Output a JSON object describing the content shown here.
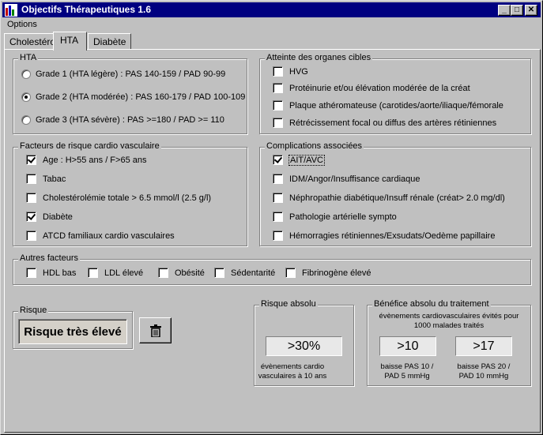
{
  "window": {
    "title": "Objectifs Thérapeutiques 1.6",
    "minimize": "_",
    "maximize": "□",
    "close": "✕"
  },
  "menu": {
    "options": "Options"
  },
  "tabs": [
    {
      "label": "Cholestérol",
      "active": false
    },
    {
      "label": "HTA",
      "active": true
    },
    {
      "label": "Diabète",
      "active": false
    }
  ],
  "hta": {
    "title": "HTA",
    "grades": [
      {
        "label": "Grade 1 (HTA légère) : PAS 140-159 / PAD 90-99",
        "selected": false
      },
      {
        "label": "Grade 2 (HTA modérée) : PAS 160-179 / PAD 100-109",
        "selected": true
      },
      {
        "label": "Grade 3 (HTA sévère) : PAS >=180 / PAD >= 110",
        "selected": false
      }
    ]
  },
  "organ_damage": {
    "title": "Atteinte des organes cibles",
    "items": [
      {
        "label": "HVG",
        "checked": false
      },
      {
        "label": "Protéinurie et/ou élévation modérée de la créat",
        "checked": false
      },
      {
        "label": "Plaque athéromateuse (carotides/aorte/iliaque/fémorale",
        "checked": false
      },
      {
        "label": "Rétrécissement focal ou diffus des artères rétiniennes",
        "checked": false
      }
    ]
  },
  "risk_factors": {
    "title": "Facteurs de risque cardio vasculaire",
    "items": [
      {
        "label": "Age : H>55 ans / F>65 ans",
        "checked": true
      },
      {
        "label": "Tabac",
        "checked": false
      },
      {
        "label": "Cholestérolémie totale > 6.5 mmol/l (2.5 g/l)",
        "checked": false
      },
      {
        "label": "Diabète",
        "checked": true
      },
      {
        "label": "ATCD familiaux cardio vasculaires",
        "checked": false
      }
    ]
  },
  "complications": {
    "title": "Complications associées",
    "items": [
      {
        "label": "AIT/AVC",
        "checked": true
      },
      {
        "label": "IDM/Angor/Insuffisance cardiaque",
        "checked": false
      },
      {
        "label": "Néphropathie diabétique/Insuff rénale (créat> 2.0 mg/dl)",
        "checked": false
      },
      {
        "label": "Pathologie artérielle sympto",
        "checked": false
      },
      {
        "label": "Hémorragies rétiniennes/Exsudats/Oedème papillaire",
        "checked": false
      }
    ]
  },
  "other_factors": {
    "title": "Autres facteurs",
    "items": [
      {
        "label": "HDL bas",
        "checked": false
      },
      {
        "label": "LDL élevé",
        "checked": false
      },
      {
        "label": "Obésité",
        "checked": false
      },
      {
        "label": "Sédentarité",
        "checked": false
      },
      {
        "label": "Fibrinogène élevé",
        "checked": false
      }
    ]
  },
  "risk": {
    "title": "Risque",
    "value": "Risque très élevé",
    "clear_icon": "trash-icon"
  },
  "absolute_risk": {
    "title": "Risque absolu",
    "value": ">30%",
    "caption": "évènements cardio vasculaires à 10 ans"
  },
  "benefit": {
    "title": "Bénéfice absolu du traitement",
    "subtitle": "évènements cardiovasculaires évités pour 1000 malades traités",
    "items": [
      {
        "value": ">10",
        "caption": "baisse PAS 10 / PAD 5 mmHg"
      },
      {
        "value": ">17",
        "caption": "baisse PAS 20 / PAD 10 mmHg"
      }
    ]
  }
}
